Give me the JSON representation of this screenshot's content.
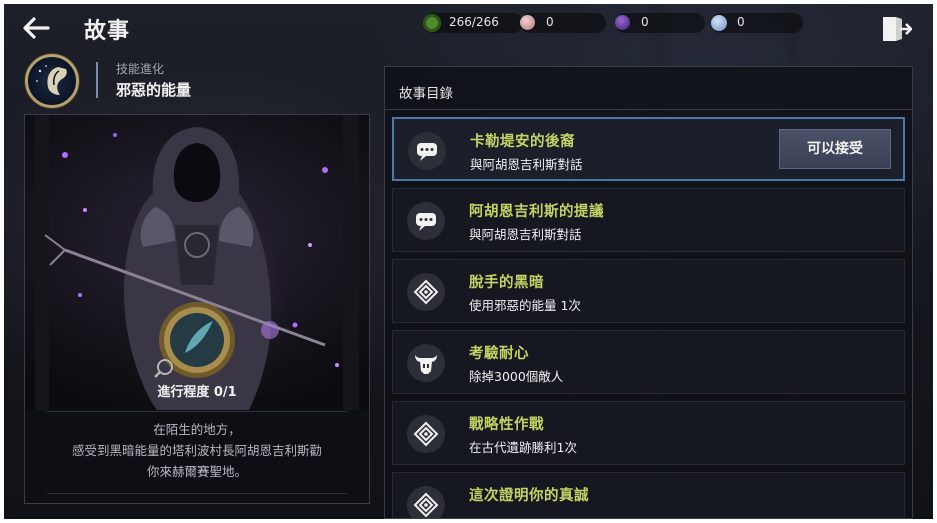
{
  "header": {
    "title": "故事",
    "resources": [
      {
        "icon": "green-gem-icon",
        "value": "266/266",
        "color": "#6fa63c"
      },
      {
        "icon": "pink-orb-icon",
        "value": "0",
        "color": "#d8a9a8"
      },
      {
        "icon": "purple-orb-icon",
        "value": "0",
        "color": "#6b3aa8"
      },
      {
        "icon": "silver-coin-icon",
        "value": "0",
        "color": "#9cb6d6"
      }
    ]
  },
  "skill": {
    "subtitle": "技能進化",
    "name": "邪惡的能量"
  },
  "story": {
    "progress": "進行程度 0/1",
    "description": "在陌生的地方，\n感受到黑暗能量的塔利波村長阿胡恩吉利斯勸\n你來赫爾賽聖地。"
  },
  "list": {
    "header": "故事目錄",
    "accept_label": "可以接受",
    "quests": [
      {
        "title": "卡勒堤安的後裔",
        "subtitle": "與阿胡恩吉利斯對話",
        "icon": "chat-bubble-icon",
        "active": true
      },
      {
        "title": "阿胡恩吉利斯的提議",
        "subtitle": "與阿胡恩吉利斯對話",
        "icon": "chat-bubble-icon",
        "active": false
      },
      {
        "title": "脫手的黑暗",
        "subtitle": "使用邪惡的能量 1次",
        "icon": "skill-rune-icon",
        "active": false
      },
      {
        "title": "考驗耐心",
        "subtitle": "除掉3000個敵人",
        "icon": "horned-helmet-icon",
        "active": false
      },
      {
        "title": "戰略性作戰",
        "subtitle": "在古代遺跡勝利1次",
        "icon": "skill-rune-icon",
        "active": false
      },
      {
        "title": "這次證明你的真誠",
        "subtitle": "",
        "icon": "skill-rune-icon",
        "active": false
      }
    ]
  },
  "colors": {
    "quest_title": "#c3d463",
    "active_border": "#4c79a6",
    "panel_border": "#3a3d46"
  }
}
